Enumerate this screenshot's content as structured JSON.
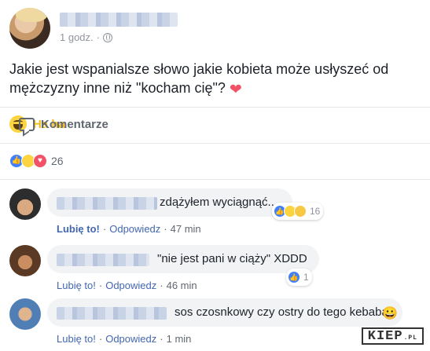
{
  "post": {
    "time": "1 godz.",
    "separator": "·",
    "text": "Jakie jest wspanialsze słowo jakie kobieta może usłyszeć od mężczyzny  inne niż \"kocham cię\"?",
    "emoji": "❤"
  },
  "actions": {
    "reaction_label": "Ha ha",
    "comment_label": "Komentarze"
  },
  "reactions": {
    "count": "26"
  },
  "comments": [
    {
      "text": "zdążyłem wyciągnąć...",
      "like_label": "Lubię to!",
      "reply_label": "Odpowiedz",
      "time": "47 min",
      "reaction_count": "16"
    },
    {
      "text": "\"nie jest pani w ciąży\" XDDD",
      "like_label": "Lubię to!",
      "reply_label": "Odpowiedz",
      "time": "46 min",
      "reaction_count": "1"
    },
    {
      "text": "sos czosnkowy czy ostry do tego kebaba?",
      "emoji": "😀",
      "like_label": "Lubię to!",
      "reply_label": "Odpowiedz",
      "time": "1 min"
    }
  ],
  "watermark": {
    "main": "KIEP",
    "suffix": ".PL"
  },
  "colors": {
    "link": "#4267b2",
    "haha": "#f0ba15",
    "love": "#f25268",
    "like": "#4080ff"
  }
}
